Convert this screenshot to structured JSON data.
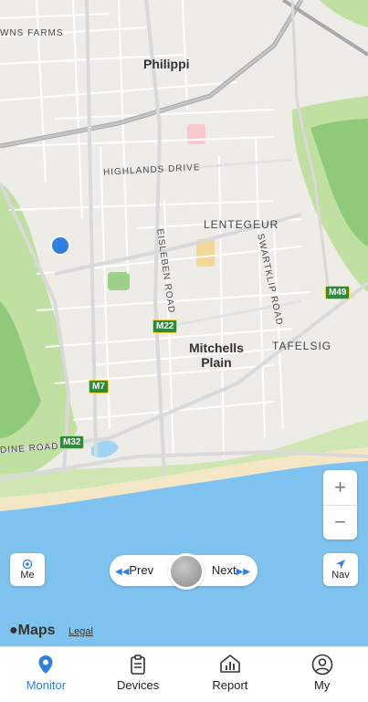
{
  "map": {
    "labels": {
      "wns_farms": "WNS FARMS",
      "philippi": "Philippi",
      "highlands_drive": "HIGHLANDS DRIVE",
      "lentegeur": "LENTEGEUR",
      "swartklip_road": "SWARTKLIP ROAD",
      "eisleben_road": "EISLEBEN ROAD",
      "mitchells_plain": "Mitchells\nPlain",
      "tafelsig": "TAFELSIG",
      "dine_road": "DINE ROAD"
    },
    "shields": {
      "m49": "M49",
      "m22": "M22",
      "m7": "M7",
      "m32": "M32"
    },
    "colors": {
      "land": "#eeece6",
      "water": "#7ec3ef",
      "park": "#bfe0a0",
      "road": "#ffffff",
      "major_road": "#a8a8a8",
      "location_dot": "#2f7fe0"
    }
  },
  "controls": {
    "zoom_in": "+",
    "zoom_out": "−",
    "me_label": "Me",
    "prev_label": "Prev",
    "next_label": "Next",
    "nav_label": "Nav"
  },
  "attribution": {
    "maps": "Maps",
    "legal": "Legal"
  },
  "tabbar": {
    "monitor": "Monitor",
    "devices": "Devices",
    "report": "Report",
    "my": "My",
    "active_color": "#2f7fe0"
  }
}
